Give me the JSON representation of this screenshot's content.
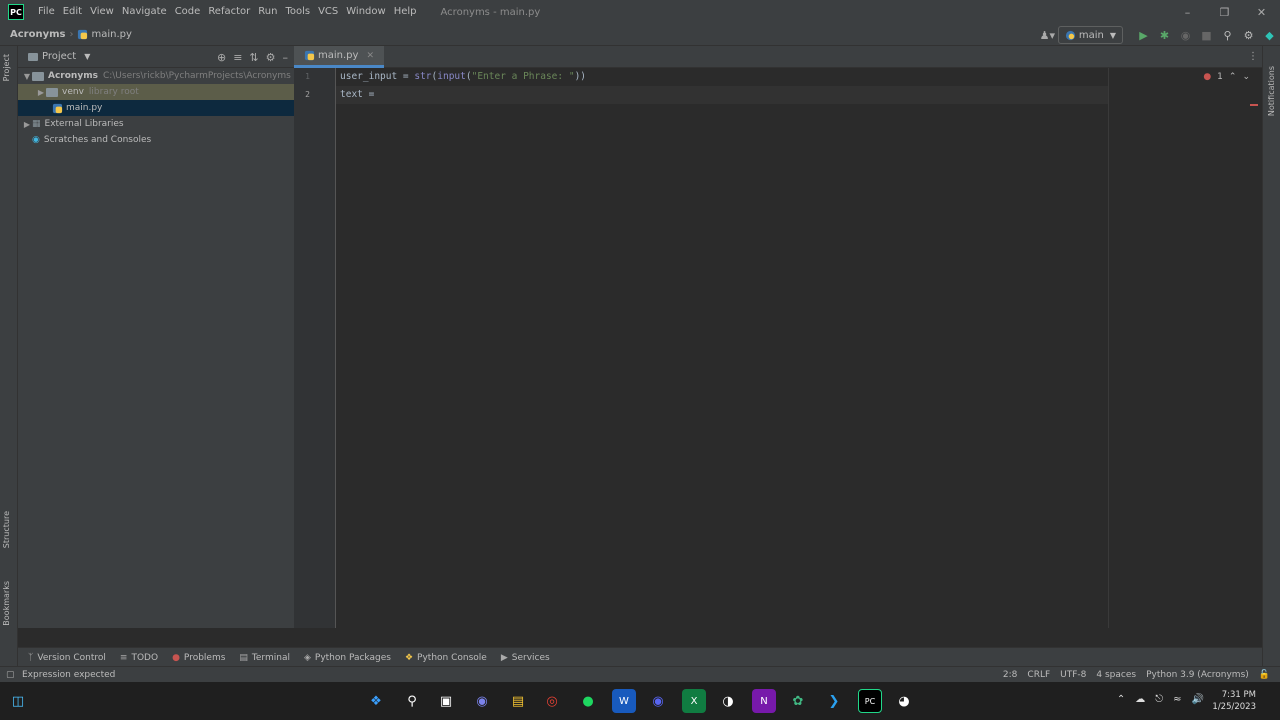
{
  "app": {
    "logo": "PC",
    "window_title": "Acronyms - main.py"
  },
  "menu": [
    "File",
    "Edit",
    "View",
    "Navigate",
    "Code",
    "Refactor",
    "Run",
    "Tools",
    "VCS",
    "Window",
    "Help"
  ],
  "breadcrumb": {
    "project": "Acronyms",
    "file": "main.py"
  },
  "run_config": {
    "label": "main"
  },
  "left_stripe": {
    "project_tab": "Project",
    "structure_tab": "Structure",
    "bookmarks_tab": "Bookmarks"
  },
  "right_stripe": {
    "notifications_tab": "Notifications"
  },
  "project_panel": {
    "title": "Project",
    "tree": {
      "root": {
        "label": "Acronyms",
        "path": "C:\\Users\\rickb\\PycharmProjects\\Acronyms"
      },
      "venv": {
        "label": "venv",
        "hint": "library root"
      },
      "main": {
        "label": "main.py"
      },
      "external": {
        "label": "External Libraries"
      },
      "scratches": {
        "label": "Scratches and Consoles"
      }
    }
  },
  "editor": {
    "tab_label": "main.py",
    "line_numbers": [
      "1",
      "2"
    ],
    "lines": {
      "l1_var": "user_input = ",
      "l1_fn1": "str",
      "l1_p1": "(",
      "l1_fn2": "input",
      "l1_p2": "(",
      "l1_str": "\"Enter a Phrase: \"",
      "l1_end": "))",
      "l2": "text = "
    },
    "inspection": {
      "error_count": "1"
    }
  },
  "tool_windows": [
    "Version Control",
    "TODO",
    "Problems",
    "Terminal",
    "Python Packages",
    "Python Console",
    "Services"
  ],
  "status": {
    "message": "Expression expected",
    "position": "2:8",
    "line_sep": "CRLF",
    "encoding": "UTF-8",
    "indent": "4 spaces",
    "interpreter": "Python 3.9 (Acronyms)"
  },
  "clock": {
    "time": "7:31 PM",
    "date": "1/25/2023"
  },
  "colors": {
    "accent": "#4a88c7",
    "string": "#6a8759",
    "builtin": "#8888c6",
    "error": "#c75450"
  }
}
